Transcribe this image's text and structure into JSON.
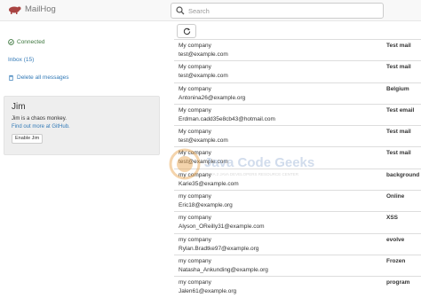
{
  "navbar": {
    "brand": "MailHog",
    "search_placeholder": "Search"
  },
  "sidebar": {
    "connected_label": "Connected",
    "inbox_label": "Inbox (15)",
    "delete_label": "Delete all messages"
  },
  "jim": {
    "title": "Jim",
    "description": "Jim is a chaos monkey.",
    "more_link": "Find out more at GitHub.",
    "enable_button": "Enable Jim"
  },
  "messages": [
    {
      "from": "My company",
      "to": "test@example.com",
      "subject": "Test mail"
    },
    {
      "from": "My company",
      "to": "test@example.com",
      "subject": "Test mail"
    },
    {
      "from": "My company",
      "to": "Antonina26@example.org",
      "subject": "Belgium"
    },
    {
      "from": "My company",
      "to": "Erdman.cadd35e8cb43@hotmail.com",
      "subject": "Test email"
    },
    {
      "from": "My company",
      "to": "test@example.com",
      "subject": "Test mail"
    },
    {
      "from": "My company",
      "to": "test@example.com",
      "subject": "Test mail"
    },
    {
      "from": "my company",
      "to": "Karie35@example.com",
      "subject": "background"
    },
    {
      "from": "my company",
      "to": "Eric18@example.org",
      "subject": "Online"
    },
    {
      "from": "my company",
      "to": "Alyson_OReilly31@example.com",
      "subject": "XSS"
    },
    {
      "from": "my company",
      "to": "Rylan.Bradtke97@example.org",
      "subject": "evolve"
    },
    {
      "from": "my company",
      "to": "Natasha_Ankunding@example.org",
      "subject": "Frozen"
    },
    {
      "from": "my company",
      "to": "Jalen61@example.org",
      "subject": "program"
    }
  ],
  "watermark": {
    "name": "Java Code Geeks",
    "tagline": "JAVA 2 JAVA DEVELOPERS RESOURCE CENTER"
  },
  "colors": {
    "link": "#337ab7",
    "connected": "#3c763d",
    "navbar_bg": "#f8f8f8",
    "panel_bg": "#eeeeee",
    "brand_logo": "#a94442"
  },
  "icons": {
    "brand": "pig-logo-icon",
    "search": "search-icon",
    "connected": "check-circle-icon",
    "delete": "trash-icon",
    "refresh": "refresh-icon"
  }
}
